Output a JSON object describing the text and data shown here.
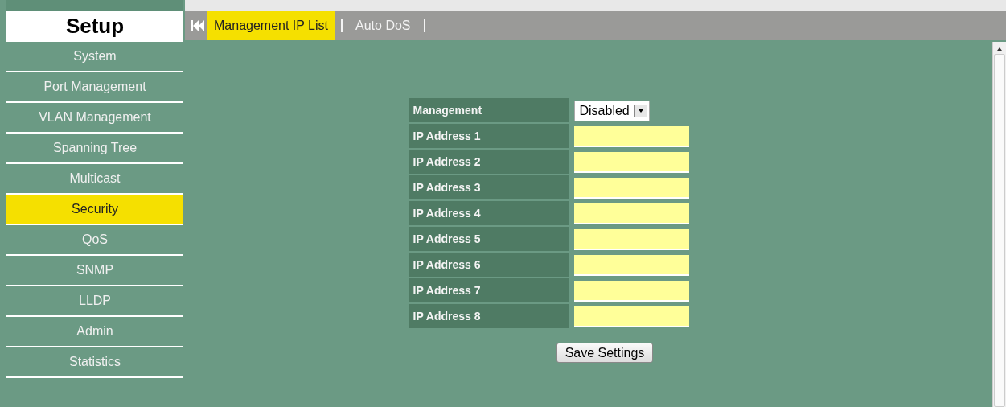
{
  "sidebar": {
    "title": "Setup",
    "items": [
      {
        "label": "System",
        "selected": false
      },
      {
        "label": "Port Management",
        "selected": false
      },
      {
        "label": "VLAN Management",
        "selected": false
      },
      {
        "label": "Spanning Tree",
        "selected": false
      },
      {
        "label": "Multicast",
        "selected": false
      },
      {
        "label": "Security",
        "selected": true
      },
      {
        "label": "QoS",
        "selected": false
      },
      {
        "label": "SNMP",
        "selected": false
      },
      {
        "label": "LLDP",
        "selected": false
      },
      {
        "label": "Admin",
        "selected": false
      },
      {
        "label": "Statistics",
        "selected": false
      }
    ]
  },
  "tabs": [
    {
      "label": "Management IP List",
      "selected": true
    },
    {
      "label": "Auto DoS",
      "selected": false
    }
  ],
  "form": {
    "management": {
      "label": "Management",
      "value": "Disabled"
    },
    "ip_addresses": [
      {
        "label": "IP Address 1"
      },
      {
        "label": "IP Address 2"
      },
      {
        "label": "IP Address 3"
      },
      {
        "label": "IP Address 4"
      },
      {
        "label": "IP Address 5"
      },
      {
        "label": "IP Address 6"
      },
      {
        "label": "IP Address 7"
      },
      {
        "label": "IP Address 8"
      }
    ],
    "save_button": "Save Settings"
  }
}
